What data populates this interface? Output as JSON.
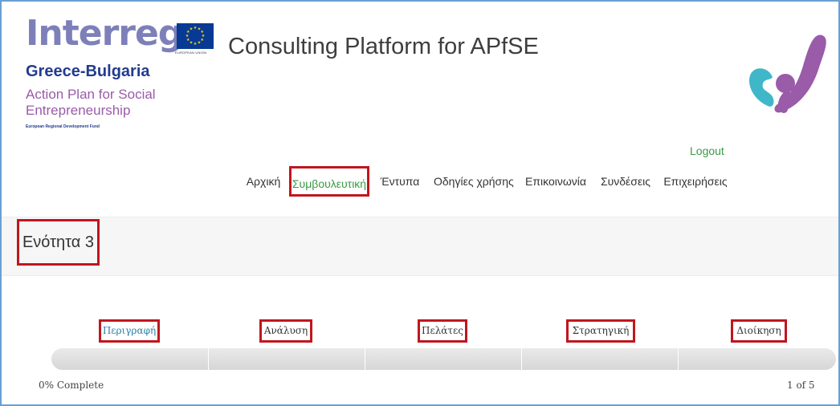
{
  "header": {
    "logo": {
      "interreg": "Interreg",
      "eu_caption": "EUROPEAN UNION",
      "program": "Greece-Bulgaria",
      "project_line1": "Action Plan for Social",
      "project_line2": "Entrepreneurship",
      "fund": "European Regional Development Fund"
    },
    "title": "Consulting Platform for APfSE",
    "logout": "Logout"
  },
  "nav": {
    "items": [
      {
        "label": "Αρχική"
      },
      {
        "label": "Συμβουλευτική",
        "active": true
      },
      {
        "label": "Έντυπα"
      },
      {
        "label": "Οδηγίες χρήσης"
      },
      {
        "label": "Επικοινωνία"
      },
      {
        "label": "Συνδέσεις"
      },
      {
        "label": "Επιχειρήσεις"
      }
    ]
  },
  "section": {
    "title": "Ενότητα 3"
  },
  "steps": {
    "items": [
      {
        "label": "Περιγραφή",
        "current": true
      },
      {
        "label": "Ανάλυση"
      },
      {
        "label": "Πελάτες"
      },
      {
        "label": "Στρατηγική"
      },
      {
        "label": "Διοίκηση"
      }
    ],
    "progress_fraction": 0.0,
    "progress_text": "0% Complete",
    "page_count": "1 of 5"
  },
  "colors": {
    "accent_green": "#3a9a45",
    "link_blue": "#2a7ea8",
    "highlight_red": "#c0161e",
    "brand_purple": "#9a5ba9",
    "brand_teal": "#3fb7c9",
    "eu_blue": "#073a94"
  },
  "icons": {
    "eu_flag": "eu-flag-icon",
    "brand": "apfse-brand-icon"
  }
}
